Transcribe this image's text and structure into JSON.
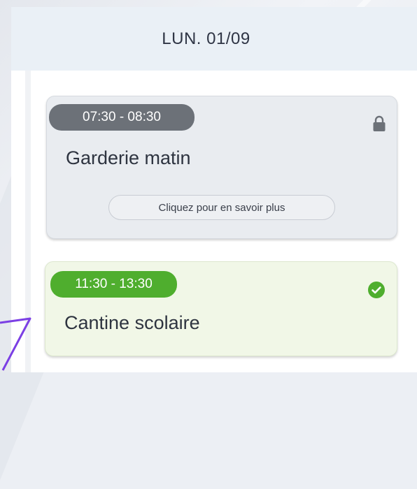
{
  "day_header": "LUN. 01/09",
  "activities": [
    {
      "time": "07:30 - 08:30",
      "title": "Garderie matin",
      "more_label": "Cliquez pour en savoir plus",
      "status_icon": "lock-icon"
    },
    {
      "time": "11:30 - 13:30",
      "title": "Cantine scolaire",
      "status_icon": "check-circle-icon"
    }
  ],
  "colors": {
    "header_bg": "#eaf0f6",
    "locked_pill": "#6c7178",
    "done_pill": "#4fae2e",
    "done_card_bg": "#f1f7e7",
    "accent_arrow": "#7b3fe4"
  }
}
